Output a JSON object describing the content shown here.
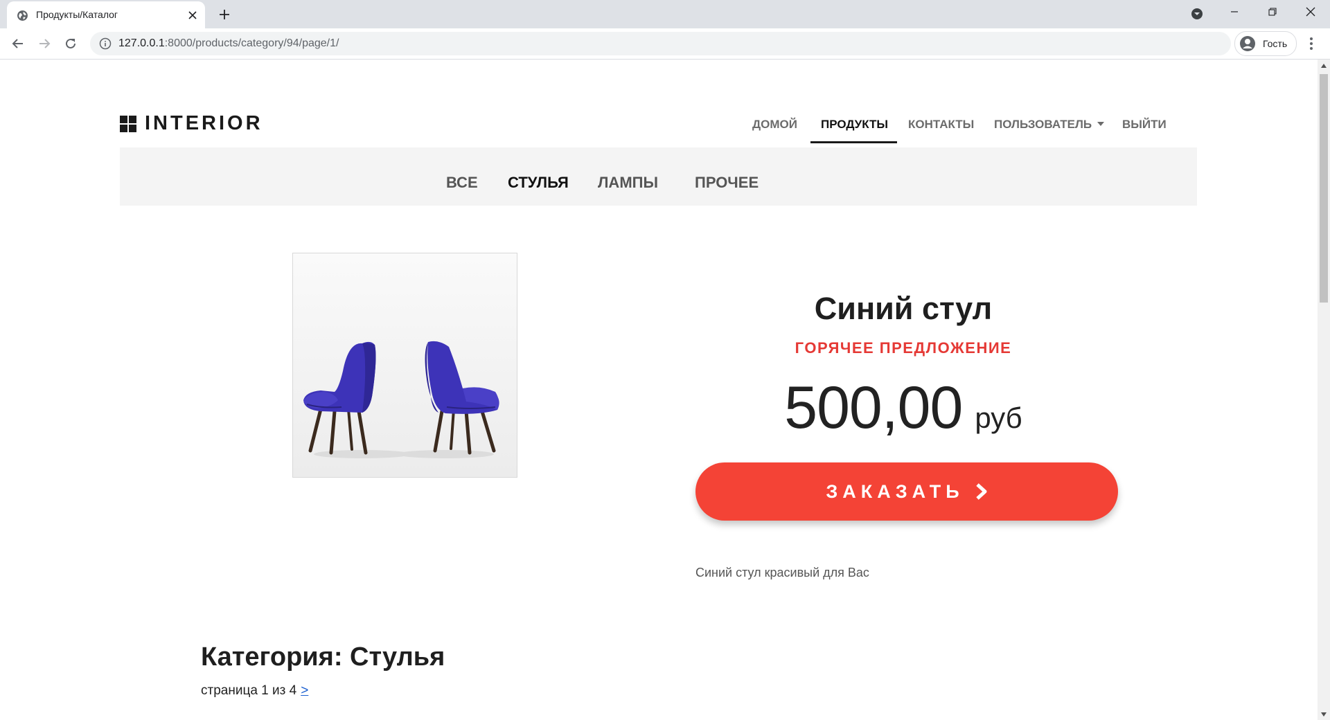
{
  "browser": {
    "tab_title": "Продукты/Каталог",
    "url_host": "127.0.0.1",
    "url_rest": ":8000/products/category/94/page/1/",
    "guest_label": "Гость",
    "icons": [
      "globe-icon",
      "close-icon",
      "plus-icon",
      "back-icon",
      "forward-icon",
      "reload-icon",
      "info-icon",
      "user-avatar-icon",
      "kebab-icon",
      "minimize-icon",
      "maximize-icon"
    ]
  },
  "site": {
    "logo_text": "INTERIOR",
    "nav": {
      "home": "ДОМОЙ",
      "products": "ПРОДУКТЫ",
      "contacts": "КОНТАКТЫ",
      "user": "ПОЛЬЗОВАТЕЛЬ",
      "logout": "ВЫЙТИ"
    },
    "categories": {
      "all": "ВСЕ",
      "chairs": "СТУЛЬЯ",
      "lamps": "ЛАМПЫ",
      "other": "ПРОЧЕЕ"
    }
  },
  "product": {
    "title": "Синий стул",
    "tag": "ГОРЯЧЕЕ ПРЕДЛОЖЕНИЕ",
    "price": "500,00",
    "currency": "руб",
    "order_label": "ЗАКАЗАТЬ",
    "description": "Синий стул красивый для Вас"
  },
  "category_section": {
    "heading": "Категория: Стулья",
    "pager_text": "страница 1 из 4",
    "pager_next": ">"
  },
  "colors": {
    "accent": "#f44336",
    "hot_offer": "#e53935",
    "chair_blue": "#3d33b8"
  }
}
